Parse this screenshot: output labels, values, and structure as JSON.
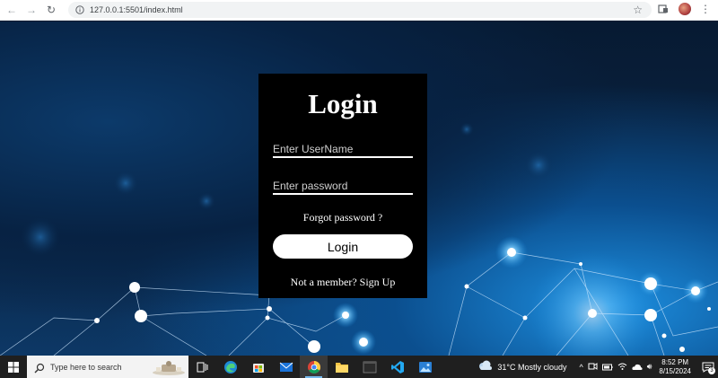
{
  "browser": {
    "url": "127.0.0.1:5501/index.html",
    "icons": [
      "back-arrow-icon",
      "forward-arrow-icon",
      "reload-icon",
      "site-info-icon",
      "bookmark-star-icon",
      "extensions-icon",
      "profile-avatar",
      "menu-dots-icon"
    ]
  },
  "login": {
    "title": "Login",
    "username_placeholder": "Enter UserName",
    "password_placeholder": "Enter password",
    "forgot": "Forgot password ?",
    "button": "Login",
    "signup": "Not a member? Sign Up"
  },
  "taskbar": {
    "search_placeholder": "Type here to search",
    "apps": [
      "task-view",
      "edge",
      "microsoft-store",
      "mail",
      "chrome",
      "file-explorer",
      "terminal",
      "vscode",
      "photos"
    ],
    "active_app": "chrome",
    "weather_text": "31°C  Mostly cloudy",
    "time": "8:52 PM",
    "date": "8/15/2024",
    "notification_count": "3"
  },
  "colors": {
    "login_box": "#000000",
    "taskbar": "#1f1f1f",
    "background_accent": "#1d8fe0"
  }
}
